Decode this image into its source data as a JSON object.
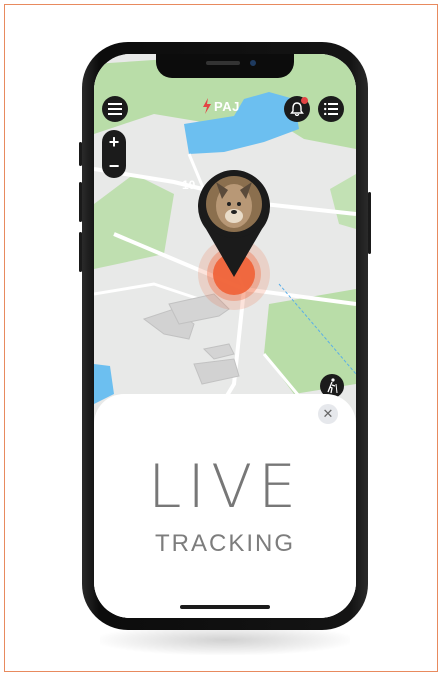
{
  "app": {
    "brand": "PAJ",
    "notification_count": "",
    "live_label": "LIVE",
    "tracking_label": "TRACKING",
    "zoom_in": "+",
    "zoom_out": "−",
    "close_symbol": "✕"
  },
  "icons": {
    "menu": "hamburger-menu-icon",
    "notifications": "bell-icon",
    "list": "list-icon",
    "pin": "location-pin-icon",
    "pet_avatar": "dog-photo",
    "walk": "hiking-person-icon",
    "close": "close-icon"
  },
  "colors": {
    "frame_border": "#e88a5e",
    "pulse": "#f0643a",
    "water": "#6cbff0",
    "park": "#b7dba5",
    "brand_red": "#e34444",
    "ui_dark": "#1b1b1b"
  }
}
